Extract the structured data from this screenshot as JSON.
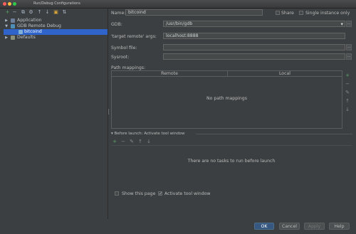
{
  "window": {
    "title": "Run/Debug Configurations",
    "traffic_colors": [
      "#fc605c",
      "#fdbc40",
      "#34c84a"
    ]
  },
  "sidebar": {
    "toolbar": [
      {
        "name": "add-icon",
        "glyph": "+"
      },
      {
        "name": "remove-icon",
        "glyph": "−"
      },
      {
        "name": "copy-icon",
        "glyph": "⧉"
      },
      {
        "name": "settings-icon",
        "glyph": "⚙"
      },
      {
        "name": "move-up-icon",
        "glyph": "↑"
      },
      {
        "name": "move-down-icon",
        "glyph": "↓"
      },
      {
        "name": "folder-icon",
        "glyph": "▣"
      },
      {
        "name": "sort-icon",
        "glyph": "⇅"
      }
    ],
    "tree": {
      "application": "Application",
      "gdb_remote_debug": "GDB Remote Debug",
      "bitcoind": "bitcoind",
      "defaults": "Defaults"
    }
  },
  "form": {
    "name_label": "Name:",
    "name_value": "bitcoind",
    "share_label": "Share",
    "single_instance_label": "Single instance only",
    "gdb_label": "GDB:",
    "gdb_value": "/usr/bin/gdb",
    "target_remote_label": "'target remote' args:",
    "target_remote_value": "localhost:8888",
    "symbol_file_label": "Symbol file:",
    "sysroot_label": "Sysroot:",
    "path_mappings_label": "Path mappings:",
    "remote_header": "Remote",
    "local_header": "Local",
    "no_mappings_text": "No path mappings",
    "before_launch_label": "Before launch: Activate tool window",
    "no_tasks_text": "There are no tasks to run before launch",
    "show_this_page_label": "Show this page",
    "activate_tool_window_label": "Activate tool window",
    "ellipsis": "...",
    "dropdown_arrow": "▾"
  },
  "buttons": {
    "ok": "OK",
    "cancel": "Cancel",
    "apply": "Apply",
    "help": "Help"
  }
}
